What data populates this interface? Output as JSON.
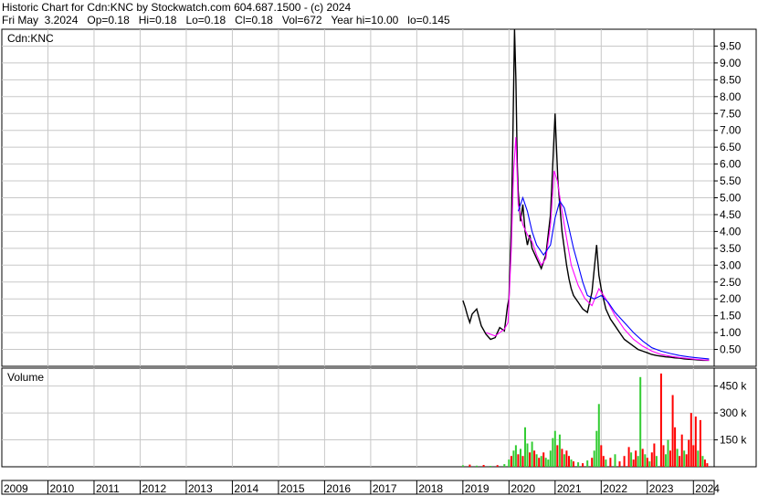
{
  "header": {
    "line1": "Historic Chart for Cdn:KNC by Stockwatch.com 604.687.1500 - (c) 2024",
    "line2": "Fri May  3.2024   Op=0.18   Hi=0.18   Lo=0.18   Cl=0.18   Vol=672   Year hi=10.00   lo=0.145"
  },
  "chart_data": [
    {
      "type": "line",
      "title": "Cdn:KNC",
      "ylim": [
        0,
        10
      ],
      "yticks": [
        "0.50",
        "1.00",
        "1.50",
        "2.00",
        "2.50",
        "3.00",
        "3.50",
        "4.00",
        "4.50",
        "5.00",
        "5.50",
        "6.00",
        "6.50",
        "7.00",
        "7.50",
        "8.00",
        "8.50",
        "9.00",
        "9.50"
      ],
      "yticks_values": [
        0.5,
        1.0,
        1.5,
        2.0,
        2.5,
        3.0,
        3.5,
        4.0,
        4.5,
        5.0,
        5.5,
        6.0,
        6.5,
        7.0,
        7.5,
        8.0,
        8.5,
        9.0,
        9.5
      ],
      "xlim": [
        2009.0,
        2024.45
      ],
      "xticks": [
        "2009",
        "2010",
        "2011",
        "2012",
        "2013",
        "2014",
        "2015",
        "2016",
        "2017",
        "2018",
        "2019",
        "2020",
        "2021",
        "2022",
        "2023",
        "2024"
      ],
      "grid": true,
      "series": [
        {
          "color": "#000000",
          "x": [
            2019.0,
            2019.05,
            2019.1,
            2019.15,
            2019.2,
            2019.3,
            2019.4,
            2019.5,
            2019.6,
            2019.7,
            2019.8,
            2019.9,
            2019.97,
            2020.0,
            2020.05,
            2020.08,
            2020.12,
            2020.15,
            2020.18,
            2020.2,
            2020.25,
            2020.3,
            2020.35,
            2020.4,
            2020.45,
            2020.5,
            2020.6,
            2020.7,
            2020.8,
            2020.9,
            2020.95,
            2021.0,
            2021.03,
            2021.06,
            2021.1,
            2021.15,
            2021.2,
            2021.25,
            2021.3,
            2021.35,
            2021.4,
            2021.5,
            2021.6,
            2021.7,
            2021.8,
            2021.9,
            2021.95,
            2022.0,
            2022.05,
            2022.1,
            2022.2,
            2022.3,
            2022.4,
            2022.5,
            2022.6,
            2022.7,
            2022.8,
            2022.9,
            2023.0,
            2023.1,
            2023.2,
            2023.3,
            2023.4,
            2023.5,
            2023.6,
            2023.7,
            2023.8,
            2023.9,
            2024.0,
            2024.1,
            2024.2,
            2024.34
          ],
          "y": [
            1.95,
            1.75,
            1.5,
            1.3,
            1.55,
            1.7,
            1.2,
            0.95,
            0.8,
            0.85,
            1.15,
            1.05,
            1.8,
            2.0,
            4.2,
            6.5,
            10.0,
            8.5,
            6.0,
            5.2,
            4.3,
            4.8,
            4.0,
            3.6,
            3.9,
            3.5,
            3.2,
            2.9,
            3.3,
            4.5,
            6.0,
            7.5,
            6.5,
            5.5,
            4.8,
            4.0,
            3.5,
            3.0,
            2.6,
            2.3,
            2.1,
            1.9,
            1.7,
            1.6,
            2.2,
            3.6,
            2.7,
            2.3,
            2.0,
            1.7,
            1.4,
            1.2,
            1.0,
            0.8,
            0.7,
            0.6,
            0.5,
            0.45,
            0.4,
            0.35,
            0.32,
            0.3,
            0.28,
            0.27,
            0.25,
            0.24,
            0.22,
            0.21,
            0.2,
            0.19,
            0.18,
            0.18
          ]
        },
        {
          "color": "#ff00ff",
          "x": [
            2019.5,
            2019.7,
            2019.9,
            2019.98,
            2020.05,
            2020.1,
            2020.15,
            2020.2,
            2020.3,
            2020.4,
            2020.5,
            2020.6,
            2020.7,
            2020.8,
            2020.9,
            2020.98,
            2021.05,
            2021.15,
            2021.25,
            2021.35,
            2021.5,
            2021.65,
            2021.8,
            2021.95,
            2022.1,
            2022.3,
            2022.5,
            2022.7,
            2022.9,
            2023.1,
            2023.3,
            2023.5,
            2023.7,
            2023.9,
            2024.1,
            2024.34
          ],
          "y": [
            1.0,
            0.9,
            1.1,
            1.3,
            3.5,
            5.8,
            6.8,
            4.8,
            4.2,
            3.9,
            3.7,
            3.3,
            3.0,
            3.2,
            4.2,
            5.8,
            5.5,
            4.6,
            3.8,
            3.0,
            2.4,
            2.0,
            1.8,
            2.3,
            2.0,
            1.5,
            1.1,
            0.8,
            0.6,
            0.45,
            0.35,
            0.3,
            0.26,
            0.23,
            0.2,
            0.18
          ]
        },
        {
          "color": "#0000ff",
          "x": [
            2020.2,
            2020.3,
            2020.4,
            2020.5,
            2020.6,
            2020.75,
            2020.9,
            2021.0,
            2021.1,
            2021.2,
            2021.3,
            2021.4,
            2021.5,
            2021.6,
            2021.7,
            2021.85,
            2022.0,
            2022.15,
            2022.3,
            2022.5,
            2022.7,
            2022.9,
            2023.1,
            2023.3,
            2023.5,
            2023.7,
            2023.9,
            2024.1,
            2024.34
          ],
          "y": [
            4.6,
            5.0,
            4.6,
            4.0,
            3.6,
            3.3,
            3.6,
            4.4,
            4.9,
            4.7,
            4.1,
            3.5,
            3.0,
            2.5,
            2.1,
            2.0,
            2.1,
            1.9,
            1.6,
            1.3,
            1.0,
            0.75,
            0.55,
            0.45,
            0.38,
            0.32,
            0.28,
            0.25,
            0.22
          ]
        }
      ]
    },
    {
      "type": "bar",
      "title": "Volume",
      "ylim": [
        0,
        550000
      ],
      "yticks": [
        "150 k",
        "300 k",
        "450 k"
      ],
      "yticks_values": [
        150000,
        300000,
        450000
      ],
      "grid": true,
      "colors": {
        "up": "#33cc33",
        "down": "#ff0000"
      },
      "bars": [
        {
          "x": 2019.0,
          "v": 8000,
          "d": "up"
        },
        {
          "x": 2019.15,
          "v": 12000,
          "d": "down"
        },
        {
          "x": 2019.3,
          "v": 6000,
          "d": "up"
        },
        {
          "x": 2019.45,
          "v": 10000,
          "d": "down"
        },
        {
          "x": 2019.6,
          "v": 5000,
          "d": "up"
        },
        {
          "x": 2019.75,
          "v": 9000,
          "d": "down"
        },
        {
          "x": 2019.9,
          "v": 15000,
          "d": "up"
        },
        {
          "x": 2020.0,
          "v": 40000,
          "d": "up"
        },
        {
          "x": 2020.05,
          "v": 60000,
          "d": "down"
        },
        {
          "x": 2020.1,
          "v": 90000,
          "d": "up"
        },
        {
          "x": 2020.15,
          "v": 120000,
          "d": "up"
        },
        {
          "x": 2020.2,
          "v": 70000,
          "d": "down"
        },
        {
          "x": 2020.25,
          "v": 100000,
          "d": "up"
        },
        {
          "x": 2020.3,
          "v": 60000,
          "d": "down"
        },
        {
          "x": 2020.35,
          "v": 220000,
          "d": "up"
        },
        {
          "x": 2020.4,
          "v": 130000,
          "d": "up"
        },
        {
          "x": 2020.45,
          "v": 80000,
          "d": "down"
        },
        {
          "x": 2020.5,
          "v": 140000,
          "d": "up"
        },
        {
          "x": 2020.55,
          "v": 90000,
          "d": "down"
        },
        {
          "x": 2020.6,
          "v": 70000,
          "d": "up"
        },
        {
          "x": 2020.65,
          "v": 50000,
          "d": "down"
        },
        {
          "x": 2020.7,
          "v": 60000,
          "d": "up"
        },
        {
          "x": 2020.75,
          "v": 80000,
          "d": "down"
        },
        {
          "x": 2020.8,
          "v": 50000,
          "d": "up"
        },
        {
          "x": 2020.85,
          "v": 40000,
          "d": "up"
        },
        {
          "x": 2020.9,
          "v": 90000,
          "d": "up"
        },
        {
          "x": 2020.95,
          "v": 160000,
          "d": "up"
        },
        {
          "x": 2021.0,
          "v": 200000,
          "d": "up"
        },
        {
          "x": 2021.05,
          "v": 120000,
          "d": "down"
        },
        {
          "x": 2021.1,
          "v": 180000,
          "d": "up"
        },
        {
          "x": 2021.15,
          "v": 100000,
          "d": "down"
        },
        {
          "x": 2021.2,
          "v": 70000,
          "d": "up"
        },
        {
          "x": 2021.25,
          "v": 90000,
          "d": "down"
        },
        {
          "x": 2021.3,
          "v": 60000,
          "d": "down"
        },
        {
          "x": 2021.35,
          "v": 40000,
          "d": "up"
        },
        {
          "x": 2021.4,
          "v": 30000,
          "d": "down"
        },
        {
          "x": 2021.5,
          "v": 25000,
          "d": "up"
        },
        {
          "x": 2021.6,
          "v": 20000,
          "d": "down"
        },
        {
          "x": 2021.7,
          "v": 35000,
          "d": "up"
        },
        {
          "x": 2021.8,
          "v": 50000,
          "d": "down"
        },
        {
          "x": 2021.85,
          "v": 90000,
          "d": "up"
        },
        {
          "x": 2021.9,
          "v": 200000,
          "d": "up"
        },
        {
          "x": 2021.95,
          "v": 350000,
          "d": "up"
        },
        {
          "x": 2022.0,
          "v": 120000,
          "d": "down"
        },
        {
          "x": 2022.05,
          "v": 60000,
          "d": "down"
        },
        {
          "x": 2022.1,
          "v": 40000,
          "d": "up"
        },
        {
          "x": 2022.2,
          "v": 50000,
          "d": "down"
        },
        {
          "x": 2022.3,
          "v": 70000,
          "d": "up"
        },
        {
          "x": 2022.4,
          "v": 30000,
          "d": "down"
        },
        {
          "x": 2022.5,
          "v": 60000,
          "d": "down"
        },
        {
          "x": 2022.6,
          "v": 110000,
          "d": "down"
        },
        {
          "x": 2022.65,
          "v": 80000,
          "d": "up"
        },
        {
          "x": 2022.7,
          "v": 40000,
          "d": "down"
        },
        {
          "x": 2022.75,
          "v": 90000,
          "d": "down"
        },
        {
          "x": 2022.8,
          "v": 60000,
          "d": "up"
        },
        {
          "x": 2022.85,
          "v": 500000,
          "d": "up"
        },
        {
          "x": 2022.9,
          "v": 100000,
          "d": "down"
        },
        {
          "x": 2022.95,
          "v": 70000,
          "d": "up"
        },
        {
          "x": 2023.0,
          "v": 50000,
          "d": "down"
        },
        {
          "x": 2023.05,
          "v": 30000,
          "d": "up"
        },
        {
          "x": 2023.1,
          "v": 80000,
          "d": "down"
        },
        {
          "x": 2023.15,
          "v": 130000,
          "d": "down"
        },
        {
          "x": 2023.2,
          "v": 60000,
          "d": "up"
        },
        {
          "x": 2023.3,
          "v": 520000,
          "d": "down"
        },
        {
          "x": 2023.35,
          "v": 120000,
          "d": "down"
        },
        {
          "x": 2023.4,
          "v": 70000,
          "d": "up"
        },
        {
          "x": 2023.45,
          "v": 150000,
          "d": "up"
        },
        {
          "x": 2023.5,
          "v": 90000,
          "d": "down"
        },
        {
          "x": 2023.55,
          "v": 400000,
          "d": "down"
        },
        {
          "x": 2023.6,
          "v": 220000,
          "d": "down"
        },
        {
          "x": 2023.65,
          "v": 100000,
          "d": "up"
        },
        {
          "x": 2023.7,
          "v": 60000,
          "d": "down"
        },
        {
          "x": 2023.75,
          "v": 180000,
          "d": "down"
        },
        {
          "x": 2023.8,
          "v": 90000,
          "d": "up"
        },
        {
          "x": 2023.85,
          "v": 70000,
          "d": "down"
        },
        {
          "x": 2023.9,
          "v": 150000,
          "d": "down"
        },
        {
          "x": 2023.95,
          "v": 300000,
          "d": "down"
        },
        {
          "x": 2024.0,
          "v": 120000,
          "d": "down"
        },
        {
          "x": 2024.05,
          "v": 280000,
          "d": "down"
        },
        {
          "x": 2024.1,
          "v": 90000,
          "d": "up"
        },
        {
          "x": 2024.15,
          "v": 260000,
          "d": "down"
        },
        {
          "x": 2024.2,
          "v": 60000,
          "d": "up"
        },
        {
          "x": 2024.25,
          "v": 40000,
          "d": "down"
        },
        {
          "x": 2024.3,
          "v": 20000,
          "d": "down"
        }
      ]
    }
  ]
}
